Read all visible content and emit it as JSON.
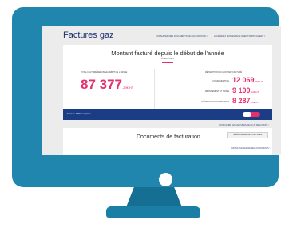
{
  "page": {
    "title": "Factures gaz",
    "links": [
      "CONSULTER MES DOCUMENTS DE FACTURATION >",
      "ACCÉDER À MON ESPACE CLIENT PARTICULIERS >"
    ]
  },
  "summary": {
    "title": "Montant facturé depuis le début de l'année",
    "subtitle": "EXERCICE 4",
    "left_label": "TOTAL FACTURÉ DEPUIS LE DÉBUT DE L'ANNÉE",
    "total_value": "87 377",
    "total_unit": ",23€ HT",
    "right_label": "RÉPARTITION DU MONTANT FACTURÉ",
    "rows": [
      {
        "label": "CONSOMMATION",
        "value": "12 069",
        "unit": ",75€ HT"
      },
      {
        "label": "ABONNEMENT ET TAXES",
        "value": "9 100",
        "unit": ",44€ HT"
      },
      {
        "label": "COÛTS DE RACCORDEMENT",
        "value": "8 287",
        "unit": ",79€ HT"
      }
    ]
  },
  "banner": {
    "text": "Facture PDF complète"
  },
  "more_link": "CONSULTER LES FACTURES DE PLUS DE 12 MOIS >",
  "documents": {
    "title": "Documents de facturation",
    "button": "TÉLÉCHARGER LES FACTURES",
    "link": "CONSULTER MES ANCIENS DOCUMENTS >"
  },
  "colors": {
    "accent": "#e6306e",
    "navy": "#1b3d85",
    "monitor": "#2186ad"
  }
}
